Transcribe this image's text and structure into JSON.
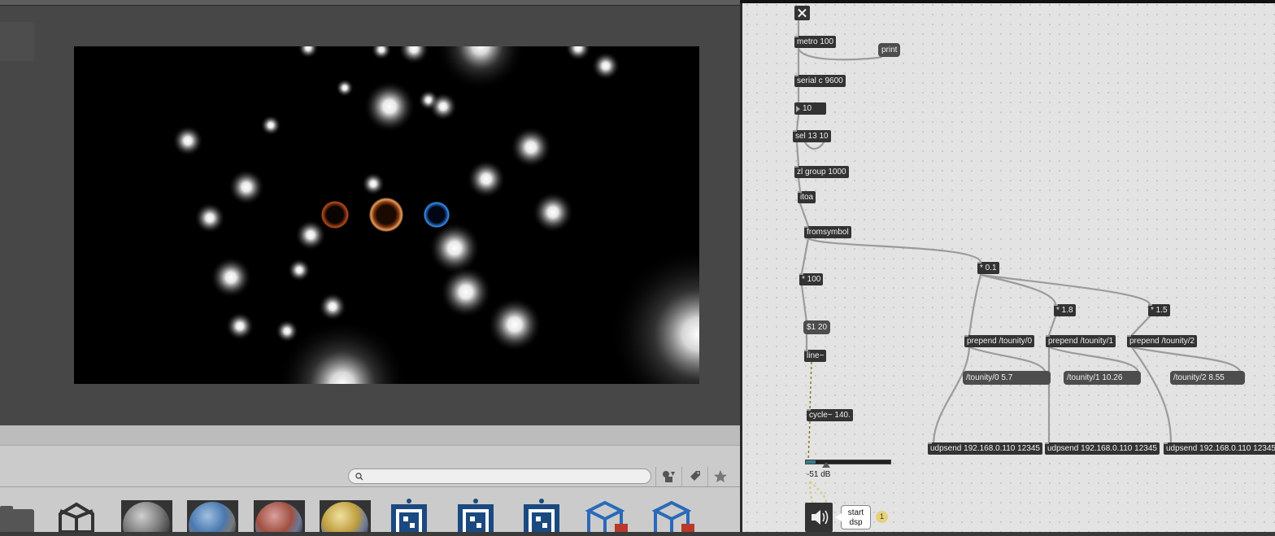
{
  "unity": {
    "search": {
      "placeholder": "",
      "value": ""
    },
    "toolbar_icons": [
      "search-icon",
      "filter-by-type-icon",
      "label-tag-icon",
      "favorite-star-icon"
    ],
    "assets": [
      "folder-icon",
      "unity-logo-icon",
      "sphere-material-grey",
      "sphere-material-blue",
      "sphere-material-red",
      "sphere-material-gold",
      "marker-icon",
      "marker-icon",
      "marker-icon",
      "prefab-cube-icon",
      "prefab-cube-icon"
    ]
  },
  "max": {
    "toggle_icon": "close-x-icon",
    "objects": {
      "metro": "metro 100",
      "print": "print",
      "serial": "serial c 9600",
      "number": "10",
      "sel": "sel 13 10",
      "zlgroup": "zl group 1000",
      "itoa": "itoa",
      "fromsymbol": "fromsymbol",
      "mul100": "* 100",
      "mul01": "* 0.1",
      "mul18": "* 1.8",
      "mul15": "* 1.5",
      "msg_ramp": "$1 20",
      "line": "line~",
      "cycle": "cycle~ 140.",
      "prepend0": "prepend /tounity/0",
      "prepend1": "prepend /tounity/1",
      "prepend2": "prepend /tounity/2",
      "out0": "/tounity/0 5.7",
      "out1": "/tounity/1 10.26",
      "out2": "/tounity/2 8.55",
      "udp0": "udpsend 192.168.0.110 12345",
      "udp1": "udpsend 192.168.0.110 12345",
      "udp2": "udpsend 192.168.0.110 12345"
    },
    "gain": {
      "label": "-51 dB",
      "level": 0.12
    },
    "dsp": {
      "line1": "start",
      "line2": "dsp",
      "badge": "1",
      "icon": "speaker-icon"
    }
  }
}
